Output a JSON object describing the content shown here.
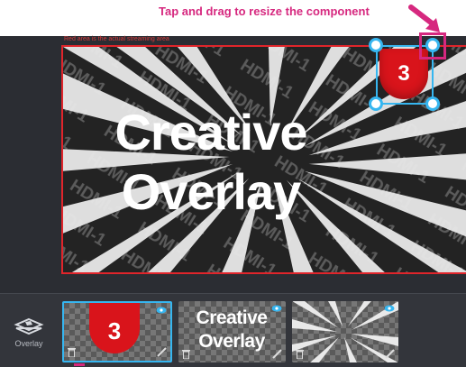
{
  "callout": {
    "text": "Tap and drag to resize the component"
  },
  "editor": {
    "canvas_hint": "Red area is the actual streaming area",
    "watermark": "HDMI-1",
    "overlay_title": {
      "line1": "Creative",
      "line2": "Overlay"
    },
    "badge_number": "3"
  },
  "tray": {
    "layer_button_label": "Overlay",
    "thumbnails": [
      {
        "kind": "badge",
        "number": "3",
        "selected": true
      },
      {
        "kind": "text",
        "line1": "Creative",
        "line2": "Overlay",
        "selected": false
      },
      {
        "kind": "burst",
        "selected": false
      }
    ]
  },
  "colors": {
    "accent": "#36b6f0",
    "callout": "#d6287f",
    "streaming_border": "#e0252b",
    "badge": "#d9141b",
    "background": "#2b2d33"
  },
  "icons": [
    "layers-icon",
    "eye-icon",
    "trash-icon",
    "pencil-icon",
    "arrow-icon"
  ]
}
